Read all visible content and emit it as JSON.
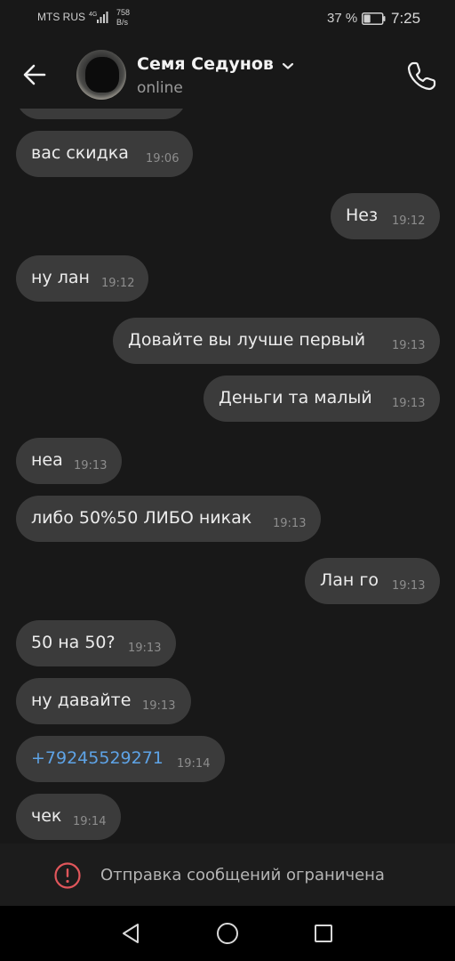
{
  "status_bar": {
    "carrier": "MTS RUS",
    "network_type": "4G",
    "speed_value": "758",
    "speed_unit": "B/s",
    "battery_percent": "37 %",
    "battery_level": 0.37,
    "time": "7:25"
  },
  "header": {
    "contact_name": "Семя Седунов",
    "contact_status": "online",
    "back_icon": "arrow-left-icon",
    "call_icon": "phone-icon"
  },
  "messages": [
    {
      "side": "in",
      "text": "вас скидка",
      "time": "19:06"
    },
    {
      "side": "out",
      "text": "Нез",
      "time": "19:12"
    },
    {
      "side": "in",
      "text": "ну лан",
      "time": "19:12"
    },
    {
      "side": "out",
      "text": "Довайте вы лучше первый",
      "time": "19:13"
    },
    {
      "side": "out",
      "text": "Деньги та малый",
      "time": "19:13"
    },
    {
      "side": "in",
      "text": "неа",
      "time": "19:13"
    },
    {
      "side": "in",
      "text": "либо 50%50 ЛИБО никак",
      "time": "19:13"
    },
    {
      "side": "out",
      "text": "Лан го",
      "time": "19:13"
    },
    {
      "side": "in",
      "text": "50 на 50?",
      "time": "19:13"
    },
    {
      "side": "in",
      "text": "ну давайте",
      "time": "19:13"
    },
    {
      "side": "in",
      "text": "+79245529271",
      "time": "19:14",
      "is_link": true
    },
    {
      "side": "in",
      "text": "чек",
      "time": "19:14"
    }
  ],
  "restriction": {
    "text": "Отправка сообщений ограничена",
    "icon": "warning-icon",
    "icon_color": "#e0565b"
  },
  "nav_bar": {
    "back_icon": "triangle-back-icon",
    "home_icon": "circle-home-icon",
    "recents_icon": "square-recents-icon"
  },
  "colors": {
    "background": "#181818",
    "bubble": "#3b3b3b",
    "link": "#5ea3e6"
  }
}
